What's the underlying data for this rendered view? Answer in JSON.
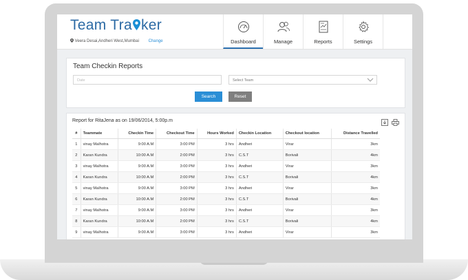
{
  "app": {
    "logo_text_1": "Team Tra",
    "logo_text_2": "ker",
    "location": "Veera Desai,Andheri West,Mumbai",
    "change_label": "Change"
  },
  "nav": {
    "items": [
      {
        "label": "Dashboard",
        "icon": "gauge-icon",
        "active": true
      },
      {
        "label": "Manage",
        "icon": "users-icon",
        "active": false
      },
      {
        "label": "Reports",
        "icon": "report-icon",
        "active": false
      },
      {
        "label": "Settings",
        "icon": "gear-icon",
        "active": false
      }
    ]
  },
  "checkin": {
    "title": "Team Checkin Reports",
    "date_placeholder": "Date",
    "team_select_value": "Select Team",
    "search_label": "Search",
    "reset_label": "Reset"
  },
  "report": {
    "title": "Report for RitaJena as on 19/06/2014, 5:00p.m",
    "columns": [
      "#",
      "Teammate",
      "Checkin Time",
      "Checkout Time",
      "Hours Worked",
      "Checkin Location",
      "Checkout location",
      "Distance Travelled"
    ],
    "rows": [
      [
        "1",
        "vinay Malhotra",
        "9:00 A.M",
        "3:00 PM",
        "3 hrs",
        "Andheri",
        "Virar",
        "3km"
      ],
      [
        "2",
        "Karan Kundra",
        "10:00 A.M",
        "2:00 PM",
        "3 hrs",
        "C.S.T",
        "Borivali",
        "4km"
      ],
      [
        "3",
        "vinay Malhotra",
        "9:00 A.M",
        "3:00 PM",
        "3 hrs",
        "Andheri",
        "Virar",
        "3km"
      ],
      [
        "4",
        "Karan Kundra",
        "10:00 A.M",
        "2:00 PM",
        "3 hrs",
        "C.S.T",
        "Borivali",
        "4km"
      ],
      [
        "5",
        "vinay Malhotra",
        "9:00 A.M",
        "3:00 PM",
        "3 hrs",
        "Andheri",
        "Virar",
        "3km"
      ],
      [
        "6",
        "Karan Kundra",
        "10:00 A.M",
        "2:00 PM",
        "3 hrs",
        "C.S.T",
        "Borivali",
        "4km"
      ],
      [
        "7",
        "vinay Malhotra",
        "9:00 A.M",
        "3:00 PM",
        "3 hrs",
        "Andheri",
        "Virar",
        "3km"
      ],
      [
        "8",
        "Karan Kundra",
        "10:00 A.M",
        "2:00 PM",
        "3 hrs",
        "C.S.T",
        "Borivali",
        "4km"
      ],
      [
        "9",
        "vinay Malhotra",
        "9:00 A.M",
        "3:00 PM",
        "3 hrs",
        "Andheri",
        "Virar",
        "3km"
      ]
    ]
  },
  "colors": {
    "brand": "#2c6aa4",
    "accent": "#2a8ed6",
    "reset": "#7f7f7f"
  }
}
